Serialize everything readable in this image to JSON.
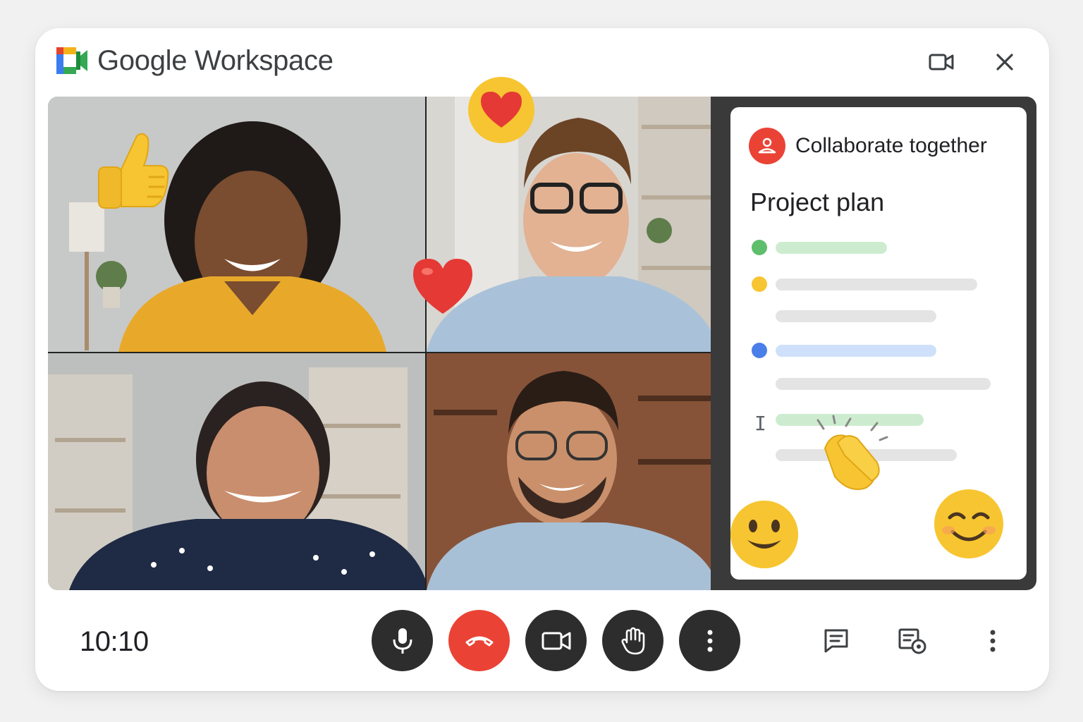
{
  "header": {
    "title": "Google Workspace",
    "icons": {
      "camera": "video-camera-icon",
      "close": "close-icon"
    }
  },
  "participants": [
    {
      "id": "participant-1",
      "reaction": "thumbs-up"
    },
    {
      "id": "participant-2",
      "reaction": "heart"
    },
    {
      "id": "participant-3",
      "reaction": ""
    },
    {
      "id": "participant-4",
      "reaction": ""
    }
  ],
  "reactions": [
    "thumbs-up-emoji",
    "heart-emoji",
    "red-heart-emoji",
    "clapping-hands-emoji",
    "smiling-face-emoji",
    "blushing-face-emoji"
  ],
  "doc_panel": {
    "heading": "Collaborate together",
    "title": "Project plan",
    "colors": {
      "green": "#5ebe6b",
      "yellow": "#f7c531",
      "blue": "#4a7ee8",
      "accent_red": "#ea4335"
    }
  },
  "footer": {
    "time": "10:10",
    "controls": [
      "microphone-icon",
      "end-call-icon",
      "camera-icon",
      "raise-hand-icon",
      "more-options-icon"
    ],
    "side": [
      "chat-icon",
      "activities-icon",
      "more-vert-icon"
    ]
  }
}
